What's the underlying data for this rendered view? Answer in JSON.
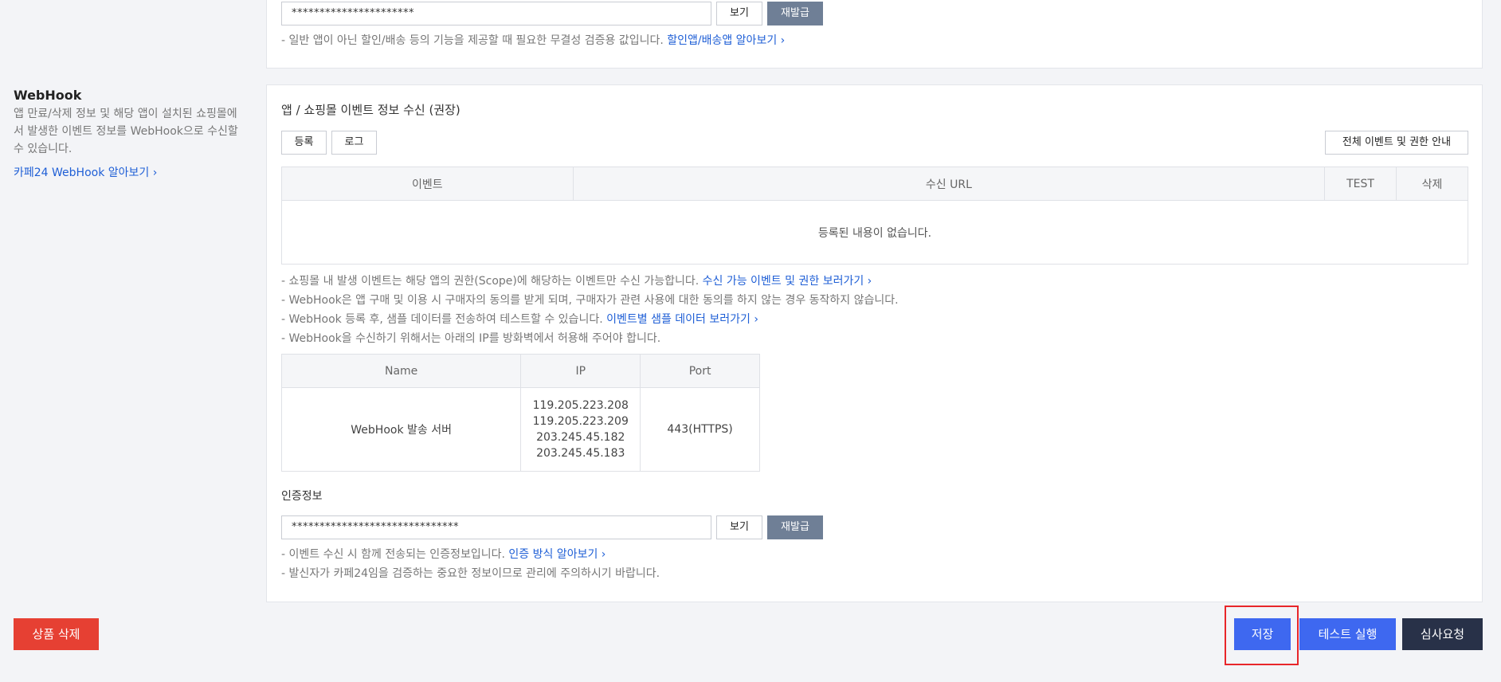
{
  "top_section": {
    "secret_value": "**********************",
    "view_button": "보기",
    "reissue_button": "재발급",
    "note_text": "- 일반 앱이 아닌 할인/배송 등의 기능을 제공할 때 필요한 무결성 검증용 값입니다.",
    "note_link": "할인앱/배송앱 알아보기 ›"
  },
  "webhook_sidebar": {
    "title": "WebHook",
    "description": "앱 만료/삭제 정보 및 해당 앱이 설치된 쇼핑몰에서 발생한 이벤트 정보를 WebHook으로 수신할 수 있습니다.",
    "link": "카페24 WebHook 알아보기 ›"
  },
  "webhook_main": {
    "section_title": "앱 / 쇼핑몰 이벤트 정보 수신 (권장)",
    "register_button": "등록",
    "log_button": "로그",
    "all_events_button": "전체 이벤트 및 권한 안내",
    "table_headers": [
      "이벤트",
      "수신 URL",
      "TEST",
      "삭제"
    ],
    "empty_message": "등록된 내용이 없습니다.",
    "notes": [
      {
        "text": "- 쇼핑몰 내 발생 이벤트는 해당 앱의 권한(Scope)에 해당하는 이벤트만 수신 가능합니다.",
        "link": "수신 가능 이벤트 및 권한 보러가기 ›"
      },
      {
        "text": "- WebHook은 앱 구매 및 이용 시 구매자의 동의를 받게 되며, 구매자가 관련 사용에 대한 동의를 하지 않는 경우 동작하지 않습니다.",
        "link": ""
      },
      {
        "text": "- WebHook 등록 후, 샘플 데이터를 전송하여 테스트할 수 있습니다.",
        "link": "이벤트별 샘플 데이터 보러가기 ›"
      },
      {
        "text": "- WebHook을 수신하기 위해서는 아래의 IP를 방화벽에서 허용해 주어야 합니다.",
        "link": ""
      }
    ],
    "ip_table": {
      "headers": [
        "Name",
        "IP",
        "Port"
      ],
      "name": "WebHook 발송 서버",
      "ips": [
        "119.205.223.208",
        "119.205.223.209",
        "203.245.45.182",
        "203.245.45.183"
      ],
      "port": "443(HTTPS)"
    },
    "auth_title": "인증정보",
    "auth_value": "******************************",
    "auth_view_button": "보기",
    "auth_reissue_button": "재발급",
    "auth_notes": [
      {
        "text": "- 이벤트 수신 시 함께 전송되는 인증정보입니다.",
        "link": "인증 방식 알아보기 ›"
      },
      {
        "text": "- 발신자가 카페24임을 검증하는 중요한 정보이므로 관리에 주의하시기 바랍니다.",
        "link": ""
      }
    ]
  },
  "footer": {
    "delete_button": "상품 삭제",
    "save_button": "저장",
    "test_button": "테스트 실행",
    "review_button": "심사요청"
  },
  "colors": {
    "link": "#1f5fd6",
    "delete": "#e64033",
    "primary": "#3e68f0",
    "dark": "#283148",
    "gray_button": "#6f7f96",
    "highlight": "#e8262a"
  }
}
